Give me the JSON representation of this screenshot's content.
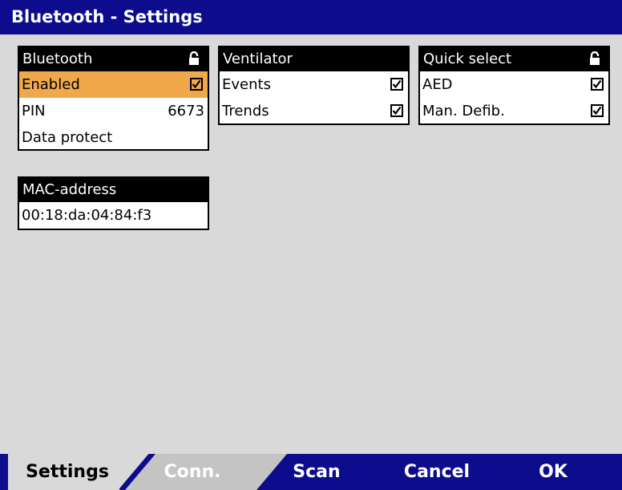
{
  "title": "Bluetooth - Settings",
  "bluetooth": {
    "header": "Bluetooth",
    "enabled_label": "Enabled",
    "enabled_checked": true,
    "pin_label": "PIN",
    "pin_value": "6673",
    "data_protect_label": "Data protect"
  },
  "ventilator": {
    "header": "Ventilator",
    "events_label": "Events",
    "events_checked": true,
    "trends_label": "Trends",
    "trends_checked": true
  },
  "quick_select": {
    "header": "Quick select",
    "aed_label": "AED",
    "aed_checked": true,
    "man_defib_label": "Man. Defib.",
    "man_defib_checked": true
  },
  "mac": {
    "header": "MAC-address",
    "value": "00:18:da:04:84:f3"
  },
  "tabs": {
    "settings": "Settings",
    "conn": "Conn.",
    "scan": "Scan",
    "cancel": "Cancel",
    "ok": "OK"
  },
  "colors": {
    "title_bg": "#0c0c8c",
    "selected_row": "#f0a84a",
    "background": "#d9d9d9"
  },
  "icons": [
    "lock-icon",
    "checkbox-checked-icon"
  ]
}
